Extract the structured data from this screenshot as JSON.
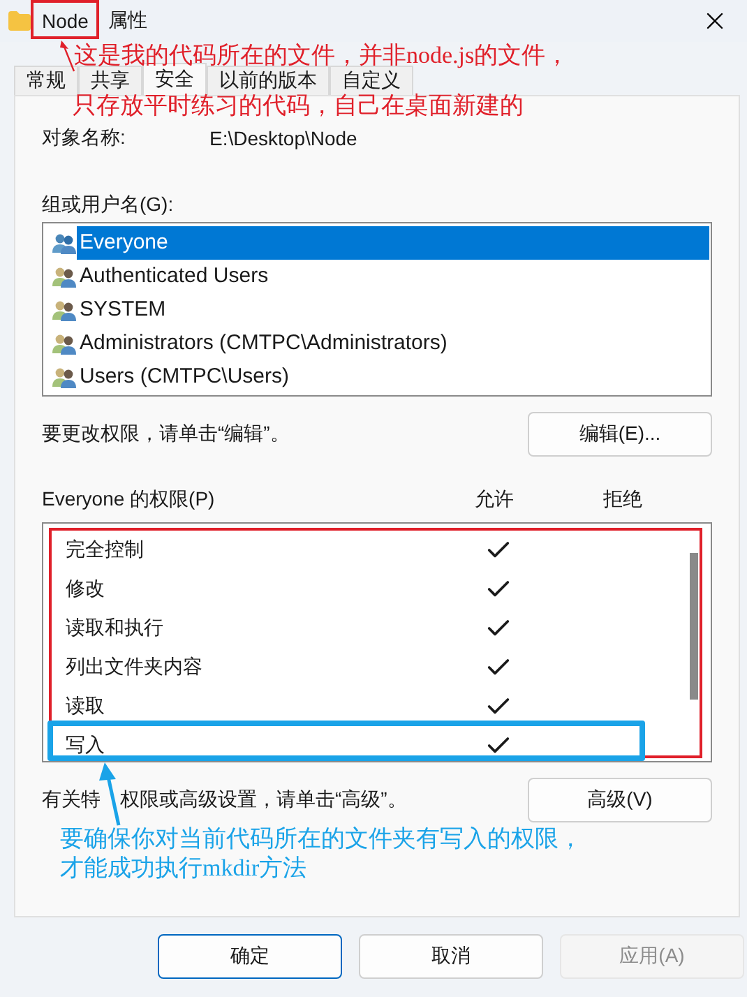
{
  "window": {
    "title_name": "Node",
    "title_suffix": "属性"
  },
  "tabs": [
    {
      "label": "常规",
      "selected": false
    },
    {
      "label": "共享",
      "selected": false
    },
    {
      "label": "安全",
      "selected": true
    },
    {
      "label": "以前的版本",
      "selected": false
    },
    {
      "label": "自定义",
      "selected": false
    }
  ],
  "object_name": {
    "label": "对象名称:",
    "value": "E:\\Desktop\\Node"
  },
  "groups": {
    "label": "组或用户名(G):",
    "users": [
      {
        "name": "Everyone",
        "kind": "everyone",
        "selected": true
      },
      {
        "name": "Authenticated Users",
        "kind": "group",
        "selected": false
      },
      {
        "name": "SYSTEM",
        "kind": "group",
        "selected": false
      },
      {
        "name": "Administrators (CMTPC\\Administrators)",
        "kind": "group",
        "selected": false
      },
      {
        "name": "Users (CMTPC\\Users)",
        "kind": "group",
        "selected": false
      }
    ]
  },
  "edit_hint": "要更改权限，请单击“编辑”。",
  "edit_button": "编辑(E)...",
  "permissions": {
    "header": "Everyone 的权限(P)",
    "columns": [
      "允许",
      "拒绝"
    ],
    "rows": [
      {
        "name": "完全控制",
        "allow": true
      },
      {
        "name": "修改",
        "allow": true
      },
      {
        "name": "读取和执行",
        "allow": true
      },
      {
        "name": "列出文件夹内容",
        "allow": true
      },
      {
        "name": "读取",
        "allow": true
      },
      {
        "name": "写入",
        "allow": true
      }
    ]
  },
  "advanced_hint": [
    "有关特",
    "权限或高级设置，请单击“高级”。"
  ],
  "advanced_button": "高级(V)",
  "buttons": [
    {
      "label": "确定",
      "kind": "default",
      "disabled": false
    },
    {
      "label": "取消",
      "kind": "normal",
      "disabled": false
    },
    {
      "label": "应用(A)",
      "kind": "normal",
      "disabled": true
    }
  ],
  "annotations": {
    "title_note": [
      "这是我的代码所在的文件，并非node.js的文件，",
      "只存放平时练习的代码，自己在桌面新建的"
    ],
    "write_note": [
      "要确保你对当前代码所在的文件夹有写入的权限，",
      "才能成功执行mkdir方法"
    ]
  }
}
